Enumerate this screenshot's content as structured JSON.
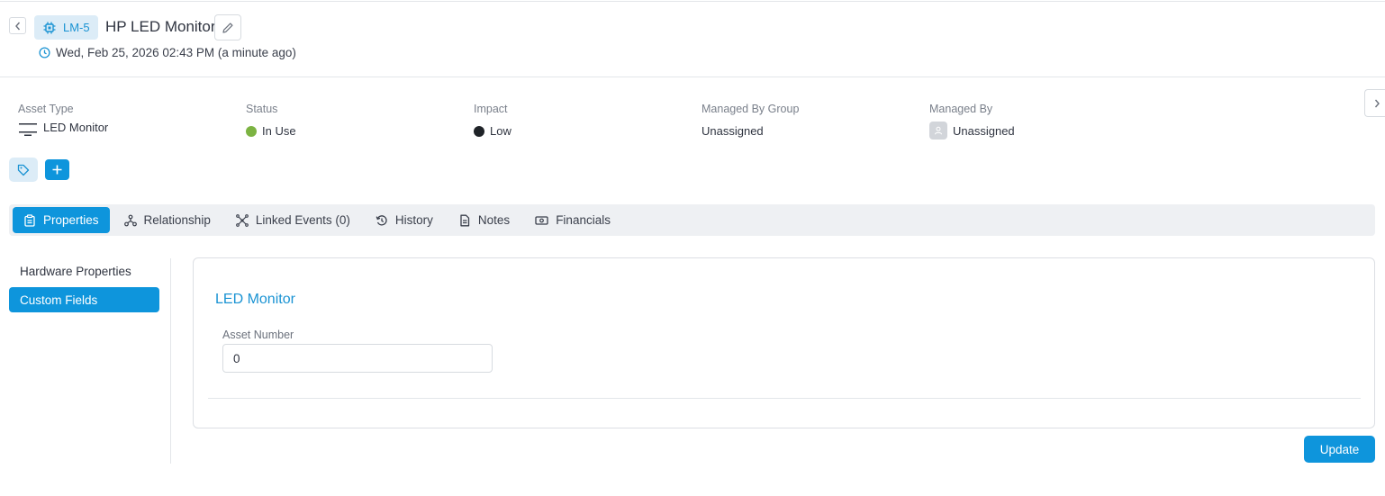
{
  "header": {
    "asset_id": "LM-5",
    "title": "HP LED Monitor",
    "timestamp": "Wed, Feb 25, 2026 02:43 PM (a minute ago)"
  },
  "summary": {
    "asset_type": {
      "label": "Asset Type",
      "value": "LED Monitor"
    },
    "status": {
      "label": "Status",
      "value": "In Use",
      "color": "#7cb342"
    },
    "impact": {
      "label": "Impact",
      "value": "Low",
      "color": "#1f2328"
    },
    "managed_by_group": {
      "label": "Managed By Group",
      "value": "Unassigned"
    },
    "managed_by": {
      "label": "Managed By",
      "value": "Unassigned"
    }
  },
  "tabs": [
    {
      "label": "Properties",
      "icon": "clipboard-icon",
      "active": true
    },
    {
      "label": "Relationship",
      "icon": "relationship-icon"
    },
    {
      "label": "Linked Events (0)",
      "icon": "linked-events-icon"
    },
    {
      "label": "History",
      "icon": "history-icon"
    },
    {
      "label": "Notes",
      "icon": "notes-icon"
    },
    {
      "label": "Financials",
      "icon": "financials-icon"
    }
  ],
  "side_nav": [
    {
      "label": "Hardware Properties",
      "active": false
    },
    {
      "label": "Custom Fields",
      "active": true
    }
  ],
  "panel": {
    "section_title": "LED Monitor",
    "field_label": "Asset Number",
    "field_value": "0"
  },
  "actions": {
    "update_label": "Update"
  },
  "colors": {
    "accent": "#0e95dc",
    "chip_bg": "#dcecf7"
  }
}
